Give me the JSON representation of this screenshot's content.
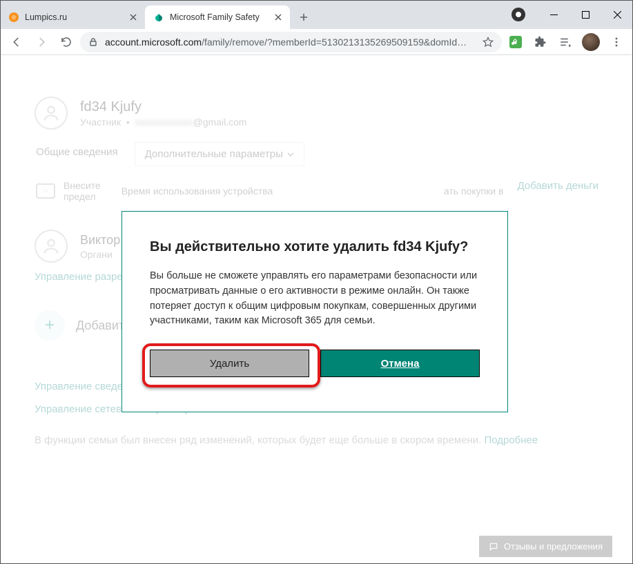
{
  "browser": {
    "tabs": [
      {
        "label": "Lumpics.ru",
        "active": false
      },
      {
        "label": "Microsoft Family Safety",
        "active": true
      }
    ],
    "url_domain": "account.microsoft.com",
    "url_path": "/family/remove/?memberId=513021313526950915​9&domId…"
  },
  "member": {
    "name": "fd34 Kjufy",
    "role": "Участник",
    "email_suffix": "@gmail.com"
  },
  "tabsrow": {
    "overview": "Общие сведения",
    "more": "Дополнительные параметры",
    "screentime": "Время использования устройства"
  },
  "card": {
    "line1": "Внесите",
    "line2": "предел",
    "col2a": "ать покупки в",
    "add_money": "Добавить деньги"
  },
  "member2": {
    "name": "Виктор",
    "role": "Органи"
  },
  "manage_perm": "Управление разре",
  "add_member": "Добавить",
  "footer": {
    "l1": "Управление сведениями детского профиля",
    "l2": "Управление сетевыми параметрами Xbox моей семьи",
    "muted": "В функции семьи был внесен ряд изменений, которых будет еще больше в скором времени.",
    "more": "Подробнее"
  },
  "modal": {
    "title": "Вы действительно хотите удалить fd34 Kjufy?",
    "body": "Вы больше не сможете управлять его параметрами безопасности или просматривать данные о его активности в режиме онлайн. Он также потеряет доступ к общим цифровым покупкам, совершенных другими участниками, таким как Microsoft 365 для семьи.",
    "delete": "Удалить",
    "cancel": "Отмена"
  },
  "feedback": "Отзывы и предложения"
}
